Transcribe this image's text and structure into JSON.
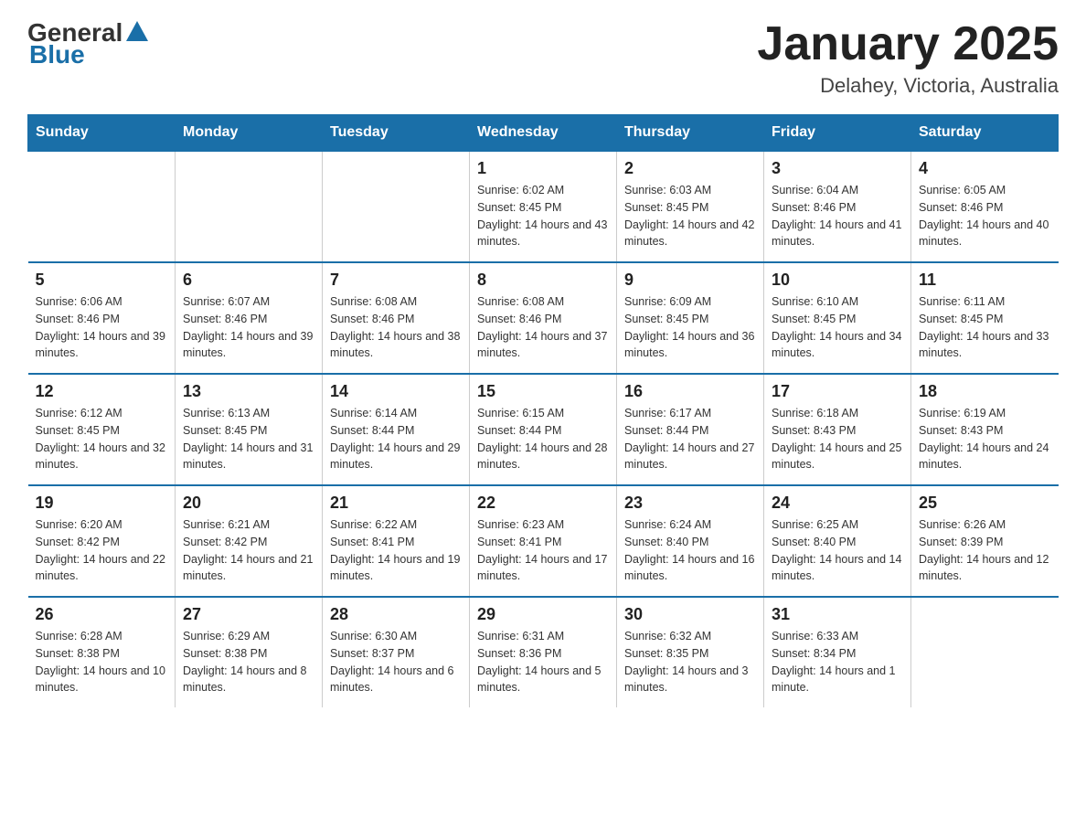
{
  "logo": {
    "general": "General",
    "blue": "Blue"
  },
  "title": "January 2025",
  "subtitle": "Delahey, Victoria, Australia",
  "days_of_week": [
    "Sunday",
    "Monday",
    "Tuesday",
    "Wednesday",
    "Thursday",
    "Friday",
    "Saturday"
  ],
  "weeks": [
    [
      {
        "day": "",
        "info": ""
      },
      {
        "day": "",
        "info": ""
      },
      {
        "day": "",
        "info": ""
      },
      {
        "day": "1",
        "info": "Sunrise: 6:02 AM\nSunset: 8:45 PM\nDaylight: 14 hours and 43 minutes."
      },
      {
        "day": "2",
        "info": "Sunrise: 6:03 AM\nSunset: 8:45 PM\nDaylight: 14 hours and 42 minutes."
      },
      {
        "day": "3",
        "info": "Sunrise: 6:04 AM\nSunset: 8:46 PM\nDaylight: 14 hours and 41 minutes."
      },
      {
        "day": "4",
        "info": "Sunrise: 6:05 AM\nSunset: 8:46 PM\nDaylight: 14 hours and 40 minutes."
      }
    ],
    [
      {
        "day": "5",
        "info": "Sunrise: 6:06 AM\nSunset: 8:46 PM\nDaylight: 14 hours and 39 minutes."
      },
      {
        "day": "6",
        "info": "Sunrise: 6:07 AM\nSunset: 8:46 PM\nDaylight: 14 hours and 39 minutes."
      },
      {
        "day": "7",
        "info": "Sunrise: 6:08 AM\nSunset: 8:46 PM\nDaylight: 14 hours and 38 minutes."
      },
      {
        "day": "8",
        "info": "Sunrise: 6:08 AM\nSunset: 8:46 PM\nDaylight: 14 hours and 37 minutes."
      },
      {
        "day": "9",
        "info": "Sunrise: 6:09 AM\nSunset: 8:45 PM\nDaylight: 14 hours and 36 minutes."
      },
      {
        "day": "10",
        "info": "Sunrise: 6:10 AM\nSunset: 8:45 PM\nDaylight: 14 hours and 34 minutes."
      },
      {
        "day": "11",
        "info": "Sunrise: 6:11 AM\nSunset: 8:45 PM\nDaylight: 14 hours and 33 minutes."
      }
    ],
    [
      {
        "day": "12",
        "info": "Sunrise: 6:12 AM\nSunset: 8:45 PM\nDaylight: 14 hours and 32 minutes."
      },
      {
        "day": "13",
        "info": "Sunrise: 6:13 AM\nSunset: 8:45 PM\nDaylight: 14 hours and 31 minutes."
      },
      {
        "day": "14",
        "info": "Sunrise: 6:14 AM\nSunset: 8:44 PM\nDaylight: 14 hours and 29 minutes."
      },
      {
        "day": "15",
        "info": "Sunrise: 6:15 AM\nSunset: 8:44 PM\nDaylight: 14 hours and 28 minutes."
      },
      {
        "day": "16",
        "info": "Sunrise: 6:17 AM\nSunset: 8:44 PM\nDaylight: 14 hours and 27 minutes."
      },
      {
        "day": "17",
        "info": "Sunrise: 6:18 AM\nSunset: 8:43 PM\nDaylight: 14 hours and 25 minutes."
      },
      {
        "day": "18",
        "info": "Sunrise: 6:19 AM\nSunset: 8:43 PM\nDaylight: 14 hours and 24 minutes."
      }
    ],
    [
      {
        "day": "19",
        "info": "Sunrise: 6:20 AM\nSunset: 8:42 PM\nDaylight: 14 hours and 22 minutes."
      },
      {
        "day": "20",
        "info": "Sunrise: 6:21 AM\nSunset: 8:42 PM\nDaylight: 14 hours and 21 minutes."
      },
      {
        "day": "21",
        "info": "Sunrise: 6:22 AM\nSunset: 8:41 PM\nDaylight: 14 hours and 19 minutes."
      },
      {
        "day": "22",
        "info": "Sunrise: 6:23 AM\nSunset: 8:41 PM\nDaylight: 14 hours and 17 minutes."
      },
      {
        "day": "23",
        "info": "Sunrise: 6:24 AM\nSunset: 8:40 PM\nDaylight: 14 hours and 16 minutes."
      },
      {
        "day": "24",
        "info": "Sunrise: 6:25 AM\nSunset: 8:40 PM\nDaylight: 14 hours and 14 minutes."
      },
      {
        "day": "25",
        "info": "Sunrise: 6:26 AM\nSunset: 8:39 PM\nDaylight: 14 hours and 12 minutes."
      }
    ],
    [
      {
        "day": "26",
        "info": "Sunrise: 6:28 AM\nSunset: 8:38 PM\nDaylight: 14 hours and 10 minutes."
      },
      {
        "day": "27",
        "info": "Sunrise: 6:29 AM\nSunset: 8:38 PM\nDaylight: 14 hours and 8 minutes."
      },
      {
        "day": "28",
        "info": "Sunrise: 6:30 AM\nSunset: 8:37 PM\nDaylight: 14 hours and 6 minutes."
      },
      {
        "day": "29",
        "info": "Sunrise: 6:31 AM\nSunset: 8:36 PM\nDaylight: 14 hours and 5 minutes."
      },
      {
        "day": "30",
        "info": "Sunrise: 6:32 AM\nSunset: 8:35 PM\nDaylight: 14 hours and 3 minutes."
      },
      {
        "day": "31",
        "info": "Sunrise: 6:33 AM\nSunset: 8:34 PM\nDaylight: 14 hours and 1 minute."
      },
      {
        "day": "",
        "info": ""
      }
    ]
  ]
}
